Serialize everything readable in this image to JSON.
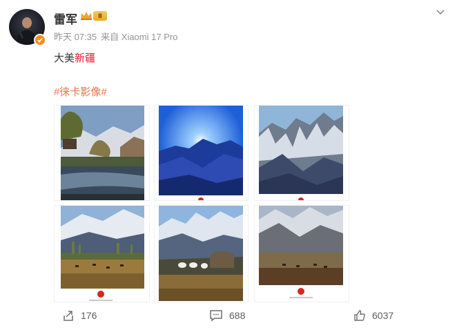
{
  "post": {
    "author": "雷军",
    "timestamp": "昨天 07:35",
    "source": "来自 Xiaomi 17 Pro",
    "text_plain": "大美",
    "text_highlight": "新疆",
    "hashtag": "#徕卡影像#",
    "vip_level": "Ⅱ"
  },
  "images": [
    {
      "name": "photo-village-river"
    },
    {
      "name": "photo-blue-mountain-sunrise"
    },
    {
      "name": "photo-snow-peaks"
    },
    {
      "name": "photo-grassland-trees"
    },
    {
      "name": "photo-yurts-mountains"
    },
    {
      "name": "photo-plateau-horses"
    }
  ],
  "actions": {
    "share_count": "176",
    "comment_count": "688",
    "like_count": "6037"
  },
  "colors": {
    "highlight": "#e6162d",
    "hashtag": "#eb7350",
    "meta_gray": "#939393",
    "verified_orange": "#f48c1b"
  },
  "icons": [
    "crown-icon",
    "verified-icon",
    "chevron-down-icon",
    "share-icon",
    "comment-icon",
    "like-icon"
  ]
}
